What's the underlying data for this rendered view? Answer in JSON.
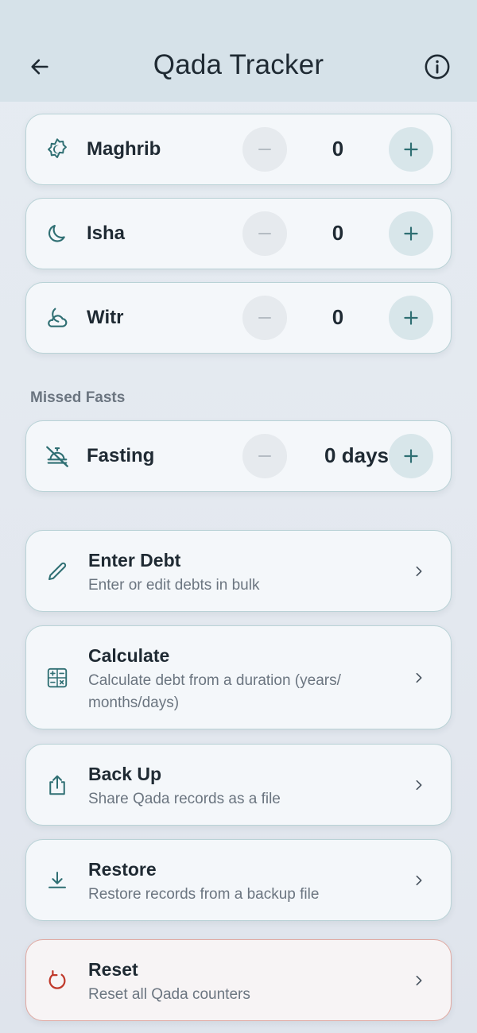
{
  "app_bar": {
    "title": "Qada Tracker",
    "back_icon": "arrow-left-icon",
    "info_icon": "info-circle-icon"
  },
  "colors": {
    "accent": "#2f6f73",
    "danger": "#c0392b",
    "app_bar_bg": "#d6e2e9",
    "card_border": "#b9d2d6"
  },
  "prayers": [
    {
      "label": "Maghrib",
      "value": "0",
      "icon": "maghrib-icon"
    },
    {
      "label": "Isha",
      "value": "0",
      "icon": "moon-icon"
    },
    {
      "label": "Witr",
      "value": "0",
      "icon": "moon-cloud-icon"
    }
  ],
  "missed_fasts": {
    "section_label": "Missed Fasts",
    "label": "Fasting",
    "value": "0 days",
    "icon": "no-food-icon"
  },
  "actions": [
    {
      "title": "Enter Debt",
      "subtitle": "Enter or edit debts in bulk",
      "icon": "pencil-icon"
    },
    {
      "title": "Calculate",
      "subtitle": "Calculate debt from a duration (years/ months/days)",
      "icon": "calculator-icon"
    },
    {
      "title": "Back Up",
      "subtitle": "Share Qada records as a file",
      "icon": "share-upload-icon"
    },
    {
      "title": "Restore",
      "subtitle": "Restore records from a backup file",
      "icon": "download-icon"
    },
    {
      "title": "Reset",
      "subtitle": "Reset all Qada counters",
      "icon": "reset-icon"
    }
  ]
}
